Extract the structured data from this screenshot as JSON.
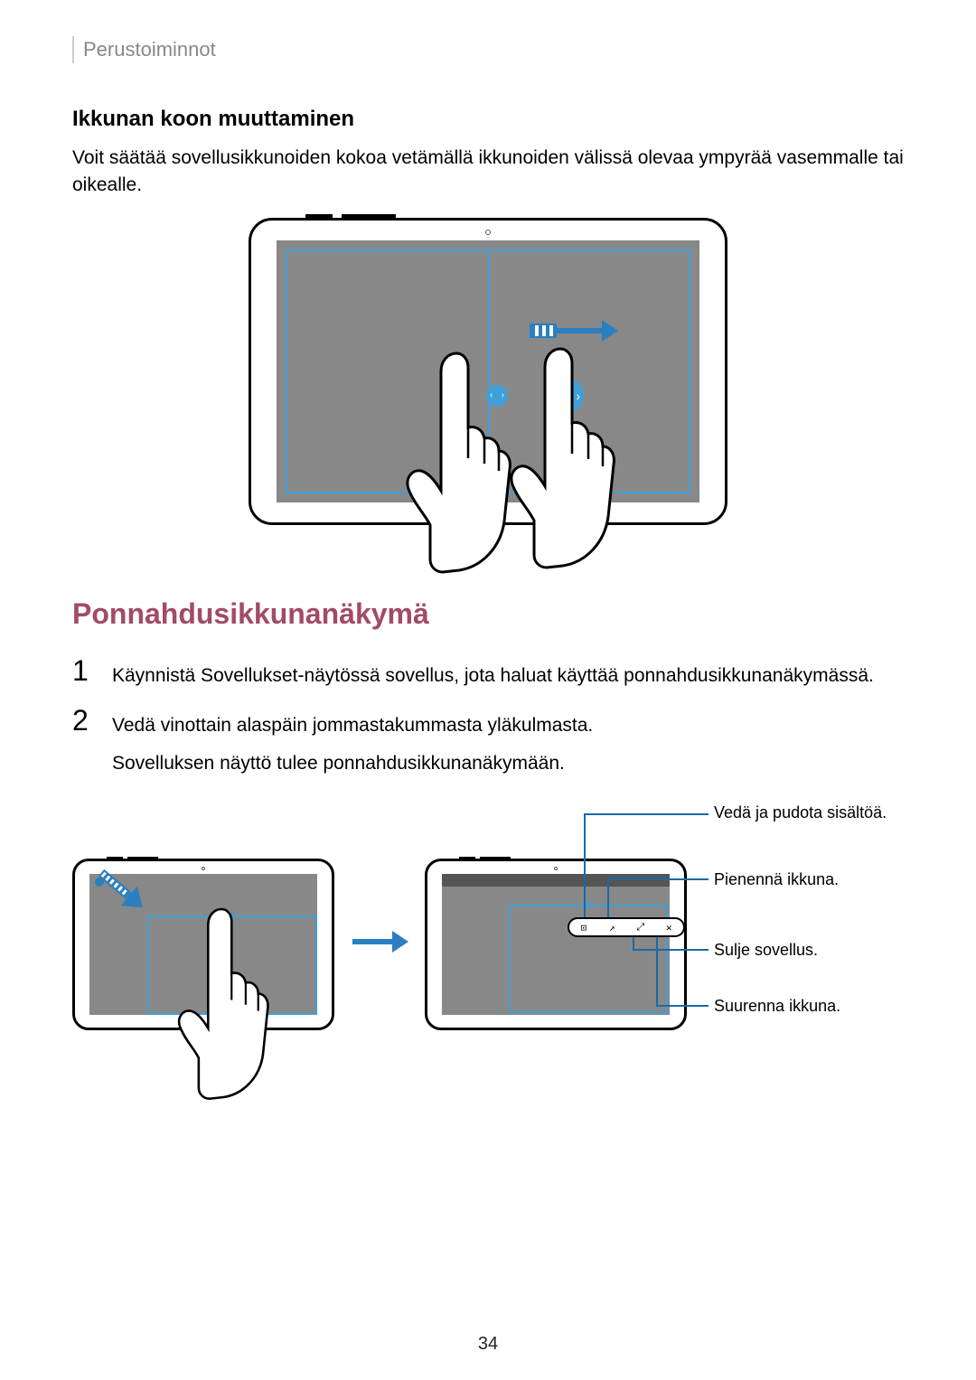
{
  "header": {
    "section": "Perustoiminnot"
  },
  "section1": {
    "heading": "Ikkunan koon muuttaminen",
    "body": "Voit säätää sovellusikkunoiden kokoa vetämällä ikkunoiden välissä olevaa ympyrää vasemmalle tai oikealle."
  },
  "section2": {
    "heading": "Ponnahdusikkunanäkymä",
    "steps": [
      {
        "num": "1",
        "text": "Käynnistä Sovellukset-näytössä sovellus, jota haluat käyttää ponnahdusikkunanäkymässä."
      },
      {
        "num": "2",
        "text": "Vedä vinottain alaspäin jommastakummasta yläkulmasta.",
        "text2": "Sovelluksen näyttö tulee ponnahdusikkunanäkymään."
      }
    ]
  },
  "callouts": {
    "drag_drop": "Vedä ja pudota sisältöä.",
    "minimize": "Pienennä ikkuna.",
    "close": "Sulje sovellus.",
    "maximize": "Suurenna ikkuna."
  },
  "toolbar_icons": {
    "drag": "⊡",
    "minimize": "↗",
    "maximize": "⤢",
    "close": "✕"
  },
  "handle_glyphs": {
    "left": "‹",
    "right": "›"
  },
  "page_number": "34"
}
